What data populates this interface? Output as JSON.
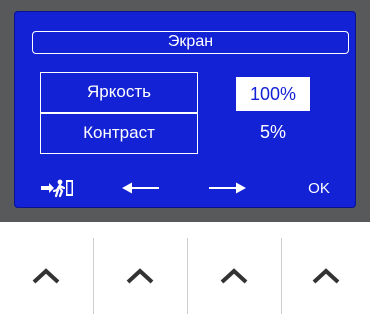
{
  "screen": {
    "title": "Экран",
    "rows": [
      {
        "label": "Яркость",
        "value": "100%",
        "selected": true
      },
      {
        "label": "Контраст",
        "value": "5%",
        "selected": false
      }
    ],
    "softkeys": {
      "exit_icon": "exit-run-icon",
      "left_icon": "arrow-left-icon",
      "right_icon": "arrow-right-icon",
      "ok_label": "OK"
    }
  },
  "keys": [
    "chevron-up-icon",
    "chevron-up-icon",
    "chevron-up-icon",
    "chevron-up-icon"
  ],
  "colors": {
    "screen_bg": "#1422d6",
    "bezel": "#58595b",
    "text": "#ffffff"
  }
}
